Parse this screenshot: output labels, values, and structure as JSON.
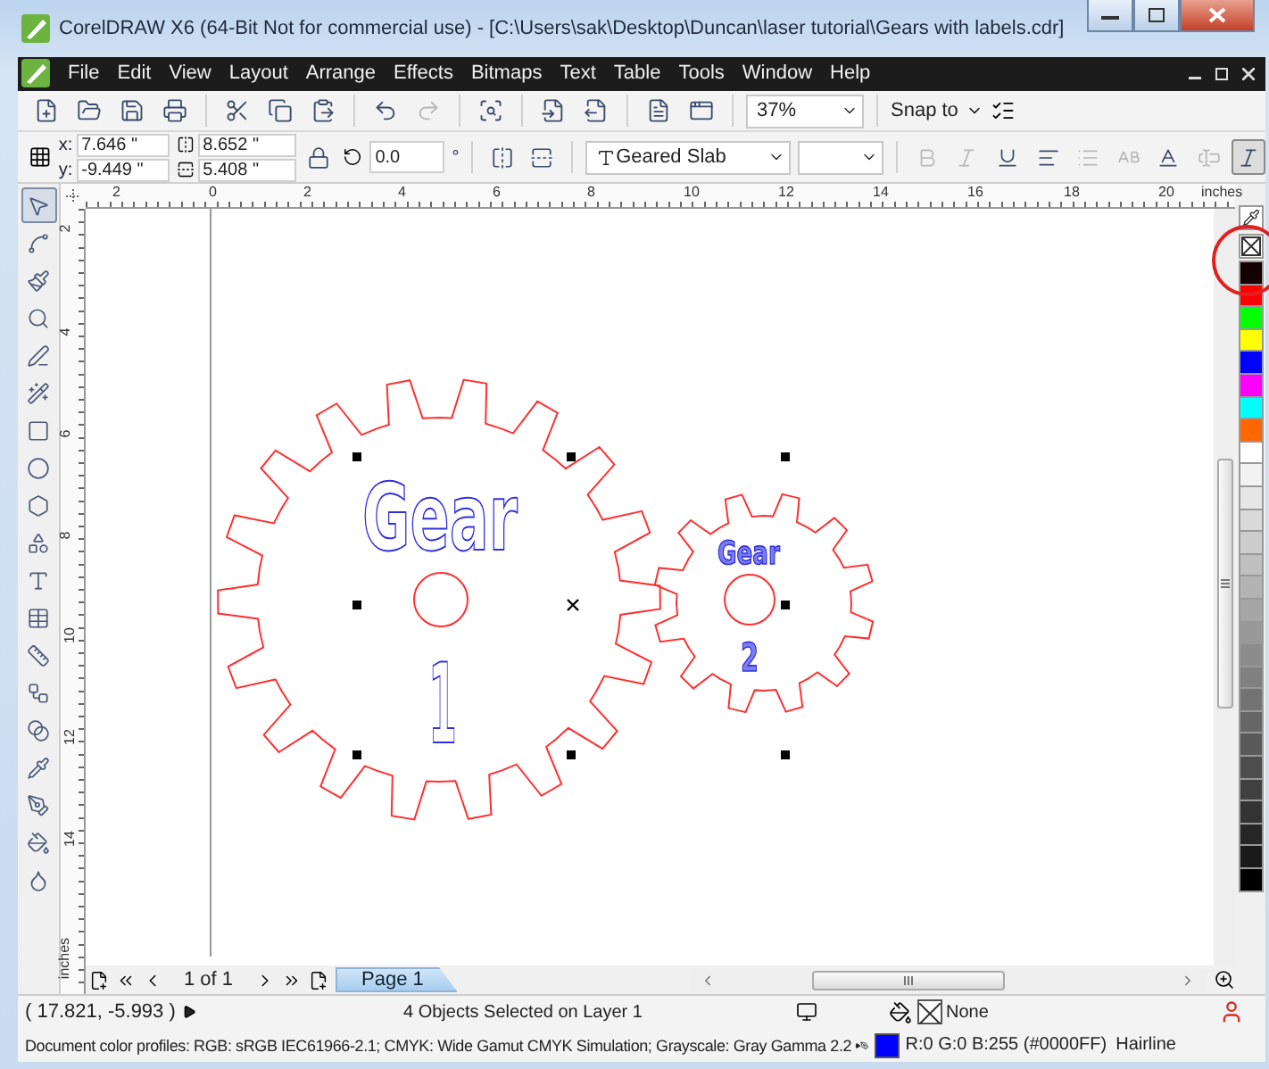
{
  "window": {
    "title": "CorelDRAW X6 (64-Bit Not for commercial use) - [C:\\Users\\sak\\Desktop\\Duncan\\laser tutorial\\Gears with labels.cdr]"
  },
  "menu": [
    {
      "label": "File"
    },
    {
      "label": "Edit"
    },
    {
      "label": "View"
    },
    {
      "label": "Layout"
    },
    {
      "label": "Arrange"
    },
    {
      "label": "Effects"
    },
    {
      "label": "Bitmaps"
    },
    {
      "label": "Text"
    },
    {
      "label": "Table"
    },
    {
      "label": "Tools"
    },
    {
      "label": "Window"
    },
    {
      "label": "Help"
    }
  ],
  "toolbar": {
    "buttons": [
      {
        "kind": "new",
        "disabled": false
      },
      {
        "kind": "open",
        "disabled": false
      },
      {
        "kind": "save",
        "disabled": false
      },
      {
        "kind": "print",
        "disabled": false
      },
      {
        "kind": "cut",
        "disabled": false
      },
      {
        "kind": "copy",
        "disabled": false
      },
      {
        "kind": "paste",
        "disabled": false
      },
      {
        "kind": "undo",
        "disabled": false
      },
      {
        "kind": "redo",
        "disabled": true
      },
      {
        "kind": "search",
        "disabled": false
      },
      {
        "kind": "import",
        "disabled": false
      },
      {
        "kind": "export",
        "disabled": false
      },
      {
        "kind": "publish",
        "disabled": false
      },
      {
        "kind": "launch",
        "disabled": false
      }
    ],
    "zoom": "37%",
    "snap": "Snap to"
  },
  "property_bar": {
    "x_label": "x:",
    "x": "7.646 \"",
    "y_label": "y:",
    "y": "-9.449 \"",
    "width": "8.652 \"",
    "height": "5.408 \"",
    "rotation": "0.0",
    "rotation_unit": "°",
    "font": "Geared Slab",
    "format_buttons": [
      {
        "kind": "bold",
        "disabled": true
      },
      {
        "kind": "italic",
        "disabled": true
      },
      {
        "kind": "underline",
        "disabled": false
      },
      {
        "kind": "align",
        "disabled": false
      },
      {
        "kind": "bullets",
        "disabled": true
      },
      {
        "kind": "dropcap",
        "disabled": true
      },
      {
        "kind": "character",
        "disabled": false
      },
      {
        "kind": "frame",
        "disabled": true
      },
      {
        "kind": "oblique",
        "disabled": false
      }
    ]
  },
  "ruler": {
    "top_unit": "inches",
    "left_unit": "inches",
    "top_ticks": [
      "2",
      "0",
      "2",
      "4",
      "6",
      "8",
      "10",
      "12",
      "14",
      "16",
      "18",
      "20"
    ],
    "left_ticks": [
      "2",
      "4",
      "6",
      "8",
      "10",
      "12",
      "14"
    ]
  },
  "tools": [
    {
      "kind": "pointer",
      "selected": true
    },
    {
      "kind": "shape",
      "selected": false
    },
    {
      "kind": "brush",
      "selected": false
    },
    {
      "kind": "zoom",
      "selected": false
    },
    {
      "kind": "line",
      "selected": false
    },
    {
      "kind": "smart",
      "selected": false
    },
    {
      "kind": "rectangle",
      "selected": false
    },
    {
      "kind": "ellipse",
      "selected": false
    },
    {
      "kind": "polygon",
      "selected": false
    },
    {
      "kind": "shapes",
      "selected": false
    },
    {
      "kind": "text",
      "selected": false
    },
    {
      "kind": "table",
      "selected": false
    },
    {
      "kind": "dimension",
      "selected": false
    },
    {
      "kind": "connector",
      "selected": false
    },
    {
      "kind": "blend",
      "selected": false
    },
    {
      "kind": "eyedropper",
      "selected": false
    },
    {
      "kind": "outline",
      "selected": false
    },
    {
      "kind": "fill",
      "selected": false
    },
    {
      "kind": "interactive_fill",
      "selected": false
    }
  ],
  "canvas": {
    "objects": [
      {
        "kind": "large_gear",
        "label": "Gear",
        "number": "1"
      },
      {
        "kind": "small_gear",
        "label": "Gear",
        "number": "2"
      }
    ]
  },
  "palette": [
    {
      "color": "#140000"
    },
    {
      "color": "#ff0000"
    },
    {
      "color": "#00ff00"
    },
    {
      "color": "#ffff00"
    },
    {
      "color": "#0000ff"
    },
    {
      "color": "#ff00ff"
    },
    {
      "color": "#00ffff"
    },
    {
      "color": "#ff6600"
    },
    {
      "color": "#ffffff"
    },
    {
      "color": "#f2f2f2"
    },
    {
      "color": "#e6e6e6"
    },
    {
      "color": "#d9d9d9"
    },
    {
      "color": "#cccccc"
    },
    {
      "color": "#bfbfbf"
    },
    {
      "color": "#b3b3b3"
    },
    {
      "color": "#a6a6a6"
    },
    {
      "color": "#999999"
    },
    {
      "color": "#8c8c8c"
    },
    {
      "color": "#808080"
    },
    {
      "color": "#737373"
    },
    {
      "color": "#666666"
    },
    {
      "color": "#595959"
    },
    {
      "color": "#4d4d4d"
    },
    {
      "color": "#404040"
    },
    {
      "color": "#333333"
    },
    {
      "color": "#262626"
    },
    {
      "color": "#1a1a1a"
    },
    {
      "color": "#000000"
    }
  ],
  "page_nav": {
    "count": "1 of 1",
    "tabs": [
      {
        "label": "Page 1",
        "selected": true
      }
    ]
  },
  "status_bar": {
    "coordinates": "( 17.821, -5.993 )",
    "selection": "4 Objects Selected on Layer 1",
    "profiles": "Document color profiles: RGB: sRGB IEC61966-2.1; CMYK: Wide Gamut CMYK Simulation; Grayscale: Gray Gamma 2.2",
    "fill": "None",
    "outline": "R:0 G:0 B:255 (#0000FF)",
    "outline_width": "Hairline"
  }
}
